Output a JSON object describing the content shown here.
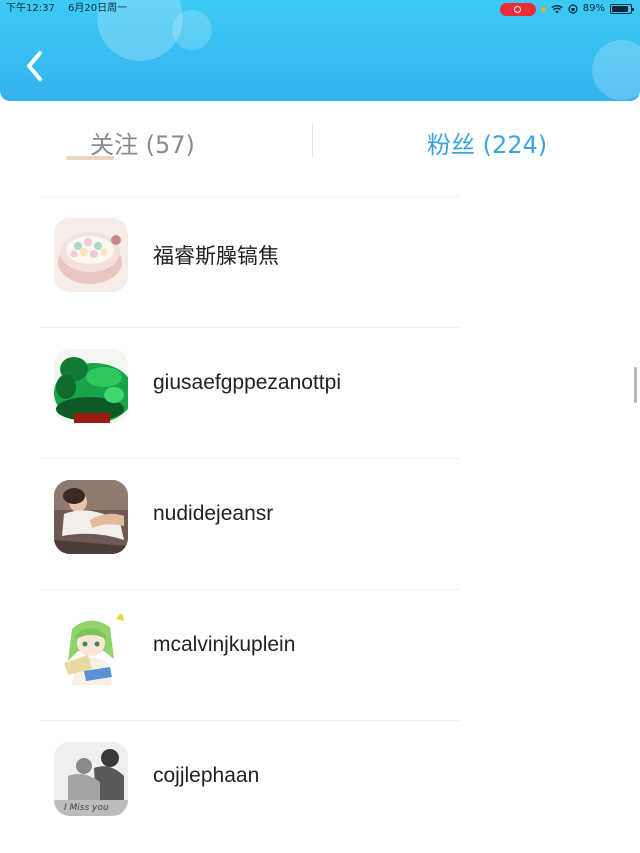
{
  "status_bar": {
    "time": "下午12:37",
    "date": "6月20日周一",
    "battery": "89%",
    "battery_level": 0.89
  },
  "tabs": {
    "following": "关注 (57)",
    "fans": "粉丝 (224)",
    "active": "fans"
  },
  "users": [
    {
      "name": "福睿斯臊镐焦",
      "avatar": "food-bowl-avatar"
    },
    {
      "name": "giusaefgppezanottpi",
      "avatar": "jade-carving-avatar"
    },
    {
      "name": "nudidejeansr",
      "avatar": "woman-photo-avatar"
    },
    {
      "name": "mcalvinjkuplein",
      "avatar": "anime-girl-avatar"
    },
    {
      "name": "cojjlephaan",
      "avatar": "couple-photo-avatar",
      "avatar_caption": "I Miss you"
    }
  ],
  "colors": {
    "header": "#35b3f0",
    "tab_active": "#3aa4e0",
    "tab_inactive": "#8a8a8a"
  }
}
